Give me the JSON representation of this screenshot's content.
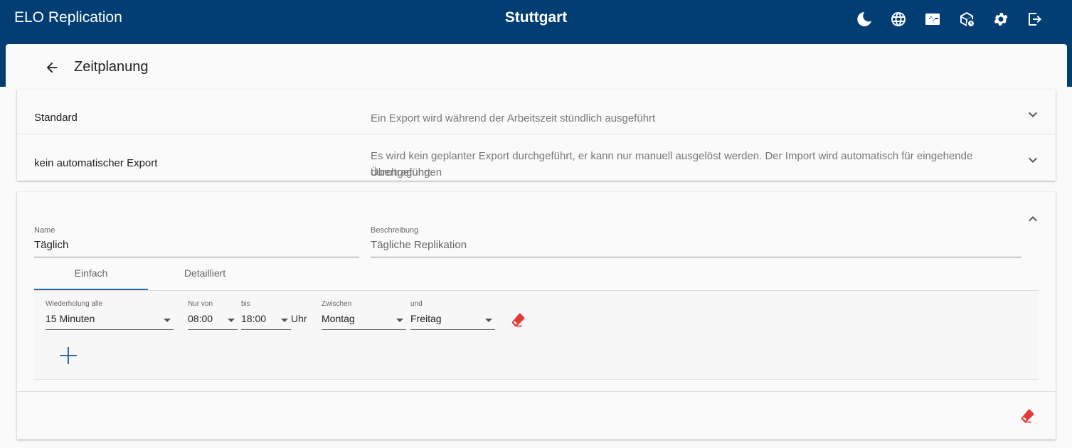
{
  "header": {
    "app_title": "ELO Replication",
    "center_title": "Stuttgart",
    "icons": [
      "moon-icon",
      "globe-icon",
      "monitor-heartbeat-icon",
      "package-clock-icon",
      "gear-icon",
      "logout-icon"
    ],
    "bg_color": "#023e74"
  },
  "page": {
    "title": "Zeitplanung"
  },
  "schedules": [
    {
      "name": "Standard",
      "description": "Ein Export wird während der Arbeitszeit stündlich ausgeführt"
    },
    {
      "name": "kein automatischer Export",
      "description_line1": "Es wird kein geplanter Export durchgeführt, er kann nur manuell ausgelöst werden. Der Import wird automatisch für eingehende Übertragungen",
      "description_line2": "durchgeführt."
    }
  ],
  "editor": {
    "name_label": "Name",
    "name_value": "Täglich",
    "desc_label": "Beschreibung",
    "desc_value": "Tägliche Replikation",
    "tabs": [
      "Einfach",
      "Detailliert"
    ],
    "active_tab": "Einfach",
    "rule": {
      "repeat_label": "Wiederholung alle",
      "repeat_value": "15 Minuten",
      "from_label": "Nur von",
      "from_value": "08:00",
      "to_label": "bis",
      "to_value": "18:00",
      "unit": "Uhr",
      "between_label": "Zwischen",
      "between_value": "Montag",
      "and_label": "und",
      "and_value": "Freitag"
    }
  },
  "colors": {
    "accent": "#2d6aa6",
    "delete": "#e53935"
  }
}
